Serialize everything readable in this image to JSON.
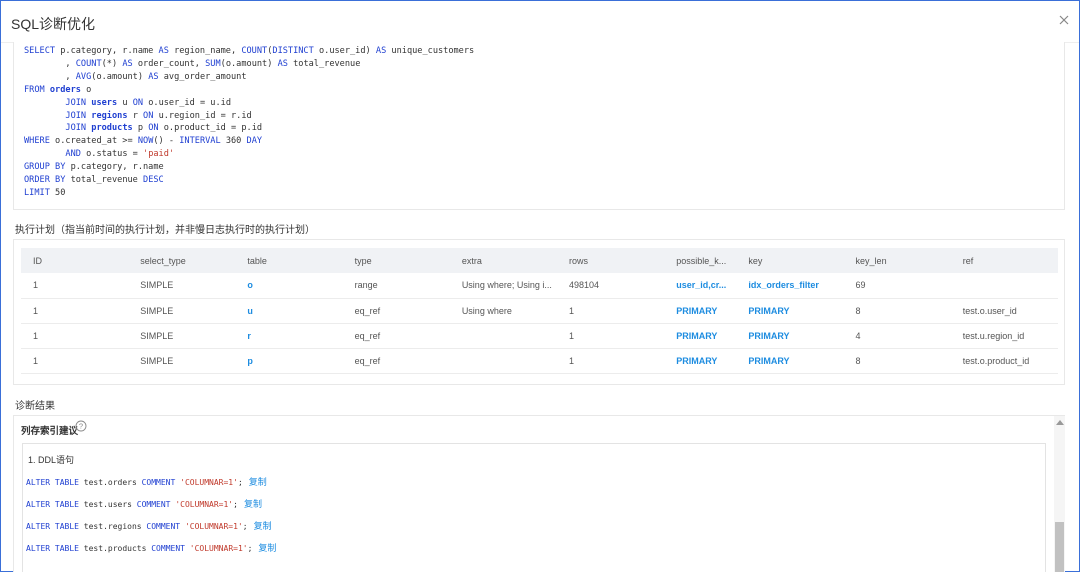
{
  "dialog": {
    "title": "SQL诊断优化"
  },
  "sql": {
    "lines": [
      [
        {
          "t": "SELECT ",
          "c": "kw"
        },
        {
          "t": "p.category, r.name ",
          "c": ""
        },
        {
          "t": "AS ",
          "c": "kw"
        },
        {
          "t": "region_name, ",
          "c": ""
        },
        {
          "t": "COUNT",
          "c": "kw"
        },
        {
          "t": "(",
          "c": ""
        },
        {
          "t": "DISTINCT ",
          "c": "kw"
        },
        {
          "t": "o.user_id) ",
          "c": ""
        },
        {
          "t": "AS ",
          "c": "kw"
        },
        {
          "t": "unique_customers",
          "c": ""
        }
      ],
      [
        {
          "t": "        , ",
          "c": ""
        },
        {
          "t": "COUNT",
          "c": "kw"
        },
        {
          "t": "(*) ",
          "c": ""
        },
        {
          "t": "AS ",
          "c": "kw"
        },
        {
          "t": "order_count, ",
          "c": ""
        },
        {
          "t": "SUM",
          "c": "kw"
        },
        {
          "t": "(o.amount) ",
          "c": ""
        },
        {
          "t": "AS ",
          "c": "kw"
        },
        {
          "t": "total_revenue",
          "c": ""
        }
      ],
      [
        {
          "t": "        , ",
          "c": ""
        },
        {
          "t": "AVG",
          "c": "kw"
        },
        {
          "t": "(o.amount) ",
          "c": ""
        },
        {
          "t": "AS ",
          "c": "kw"
        },
        {
          "t": "avg_order_amount",
          "c": ""
        }
      ],
      [
        {
          "t": "FROM ",
          "c": "kw"
        },
        {
          "t": "orders ",
          "c": "tb"
        },
        {
          "t": "o",
          "c": ""
        }
      ],
      [
        {
          "t": "        ",
          "c": ""
        },
        {
          "t": "JOIN ",
          "c": "kw"
        },
        {
          "t": "users ",
          "c": "tb"
        },
        {
          "t": "u ",
          "c": ""
        },
        {
          "t": "ON ",
          "c": "kw"
        },
        {
          "t": "o.user_id = u.id",
          "c": ""
        }
      ],
      [
        {
          "t": "        ",
          "c": ""
        },
        {
          "t": "JOIN ",
          "c": "kw"
        },
        {
          "t": "regions ",
          "c": "tb"
        },
        {
          "t": "r ",
          "c": ""
        },
        {
          "t": "ON ",
          "c": "kw"
        },
        {
          "t": "u.region_id = r.id",
          "c": ""
        }
      ],
      [
        {
          "t": "        ",
          "c": ""
        },
        {
          "t": "JOIN ",
          "c": "kw"
        },
        {
          "t": "products ",
          "c": "tb"
        },
        {
          "t": "p ",
          "c": ""
        },
        {
          "t": "ON ",
          "c": "kw"
        },
        {
          "t": "o.product_id = p.id",
          "c": ""
        }
      ],
      [
        {
          "t": "WHERE ",
          "c": "kw"
        },
        {
          "t": "o.created_at >= ",
          "c": ""
        },
        {
          "t": "NOW",
          "c": "kw"
        },
        {
          "t": "() - ",
          "c": ""
        },
        {
          "t": "INTERVAL ",
          "c": "kw"
        },
        {
          "t": "360 ",
          "c": ""
        },
        {
          "t": "DAY",
          "c": "kw"
        }
      ],
      [
        {
          "t": "        ",
          "c": ""
        },
        {
          "t": "AND ",
          "c": "kw"
        },
        {
          "t": "o.status = ",
          "c": ""
        },
        {
          "t": "'paid'",
          "c": "str"
        }
      ],
      [
        {
          "t": "GROUP BY ",
          "c": "kw"
        },
        {
          "t": "p.category, r.name",
          "c": ""
        }
      ],
      [
        {
          "t": "ORDER BY ",
          "c": "kw"
        },
        {
          "t": "total_revenue ",
          "c": ""
        },
        {
          "t": "DESC",
          "c": "kw"
        }
      ],
      [
        {
          "t": "LIMIT ",
          "c": "kw"
        },
        {
          "t": "50",
          "c": ""
        }
      ]
    ]
  },
  "plan": {
    "label": "执行计划（指当前时间的执行计划，并非慢日志执行时的执行计划）",
    "columns": [
      "ID",
      "select_type",
      "table",
      "type",
      "extra",
      "rows",
      "possible_k...",
      "key",
      "key_len",
      "ref"
    ],
    "rows": [
      [
        "1",
        "SIMPLE",
        "o",
        "range",
        "Using where; Using i...",
        "498104",
        "user_id,cr...",
        "idx_orders_filter",
        "69",
        ""
      ],
      [
        "1",
        "SIMPLE",
        "u",
        "eq_ref",
        "Using where",
        "1",
        "PRIMARY",
        "PRIMARY",
        "8",
        "test.o.user_id"
      ],
      [
        "1",
        "SIMPLE",
        "r",
        "eq_ref",
        "",
        "1",
        "PRIMARY",
        "PRIMARY",
        "4",
        "test.u.region_id"
      ],
      [
        "1",
        "SIMPLE",
        "p",
        "eq_ref",
        "",
        "1",
        "PRIMARY",
        "PRIMARY",
        "8",
        "test.o.product_id"
      ]
    ]
  },
  "diagnosis": {
    "label": "诊断结果",
    "title": "列存索引建议",
    "ddl_heading": "1. DDL语句",
    "copy_label": "复制",
    "statements": [
      {
        "prefix": "ALTER TABLE ",
        "table": "test.orders",
        "comment_kw": " COMMENT ",
        "value": "'COLUMNAR=1'",
        "end": ";"
      },
      {
        "prefix": "ALTER TABLE ",
        "table": "test.users",
        "comment_kw": " COMMENT ",
        "value": "'COLUMNAR=1'",
        "end": ";"
      },
      {
        "prefix": "ALTER TABLE ",
        "table": "test.regions",
        "comment_kw": " COMMENT ",
        "value": "'COLUMNAR=1'",
        "end": ";"
      },
      {
        "prefix": "ALTER TABLE ",
        "table": "test.products",
        "comment_kw": " COMMENT ",
        "value": "'COLUMNAR=1'",
        "end": ";"
      }
    ]
  },
  "colors": {
    "keyword": "#1f3fd1",
    "string": "#c0392b",
    "link": "#1d8ce0",
    "dialog_border": "#3a6fd8"
  }
}
